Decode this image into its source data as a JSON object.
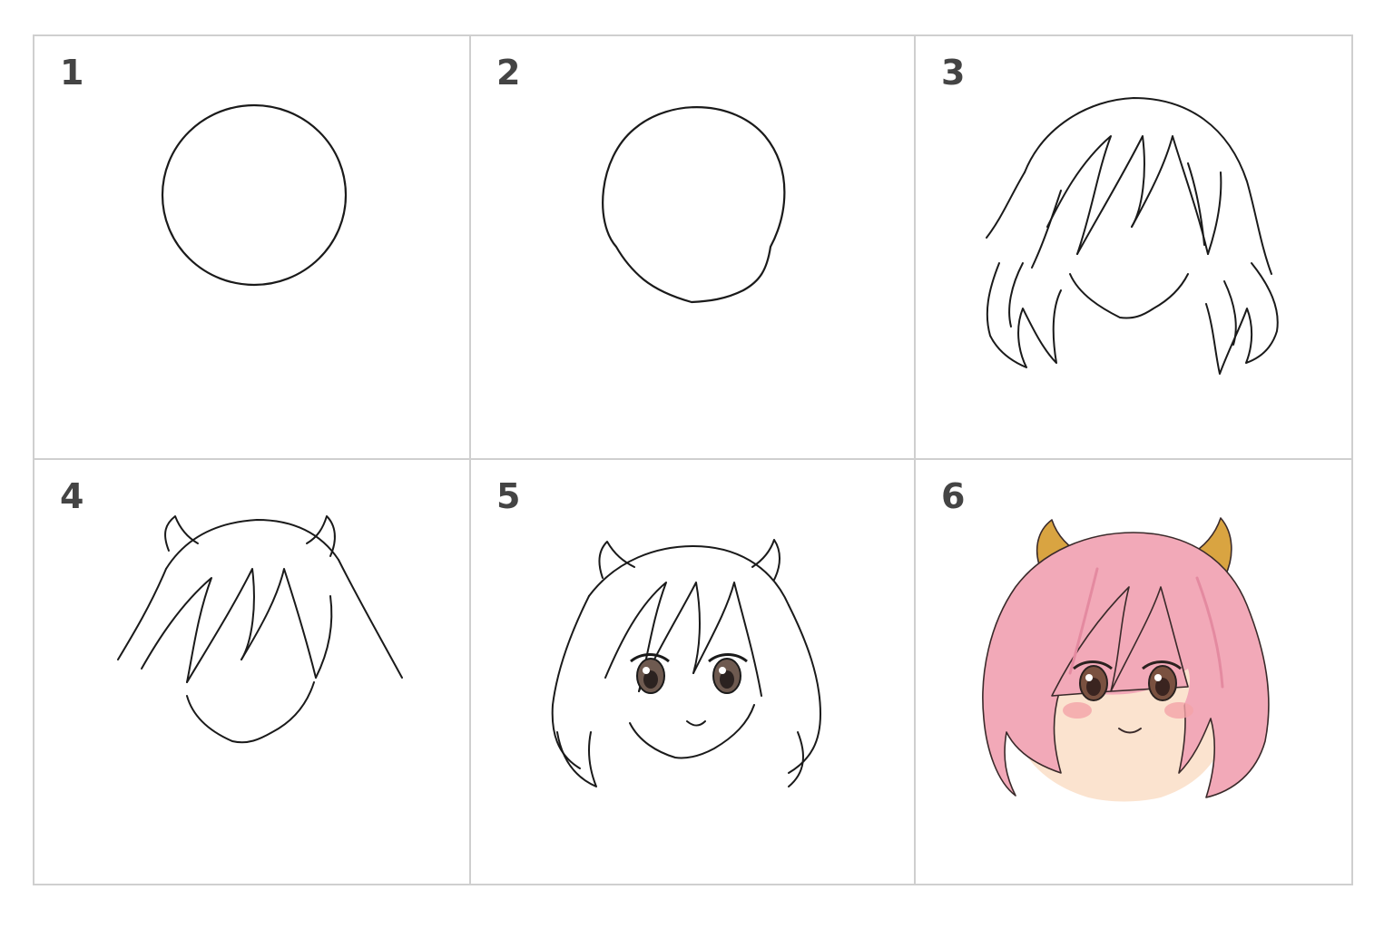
{
  "steps": [
    {
      "number": "1"
    },
    {
      "number": "2"
    },
    {
      "number": "3"
    },
    {
      "number": "4"
    },
    {
      "number": "5"
    },
    {
      "number": "6"
    }
  ],
  "colors": {
    "line": "#1a1a1a",
    "border": "#cfcfcf",
    "number": "#444444",
    "hair_fill": "#f2a9b8",
    "hair_shadow": "#e48aa0",
    "skin": "#fbe3cf",
    "horn": "#d9a441",
    "blush": "#f4a3a8",
    "iris": "#7a5140"
  }
}
